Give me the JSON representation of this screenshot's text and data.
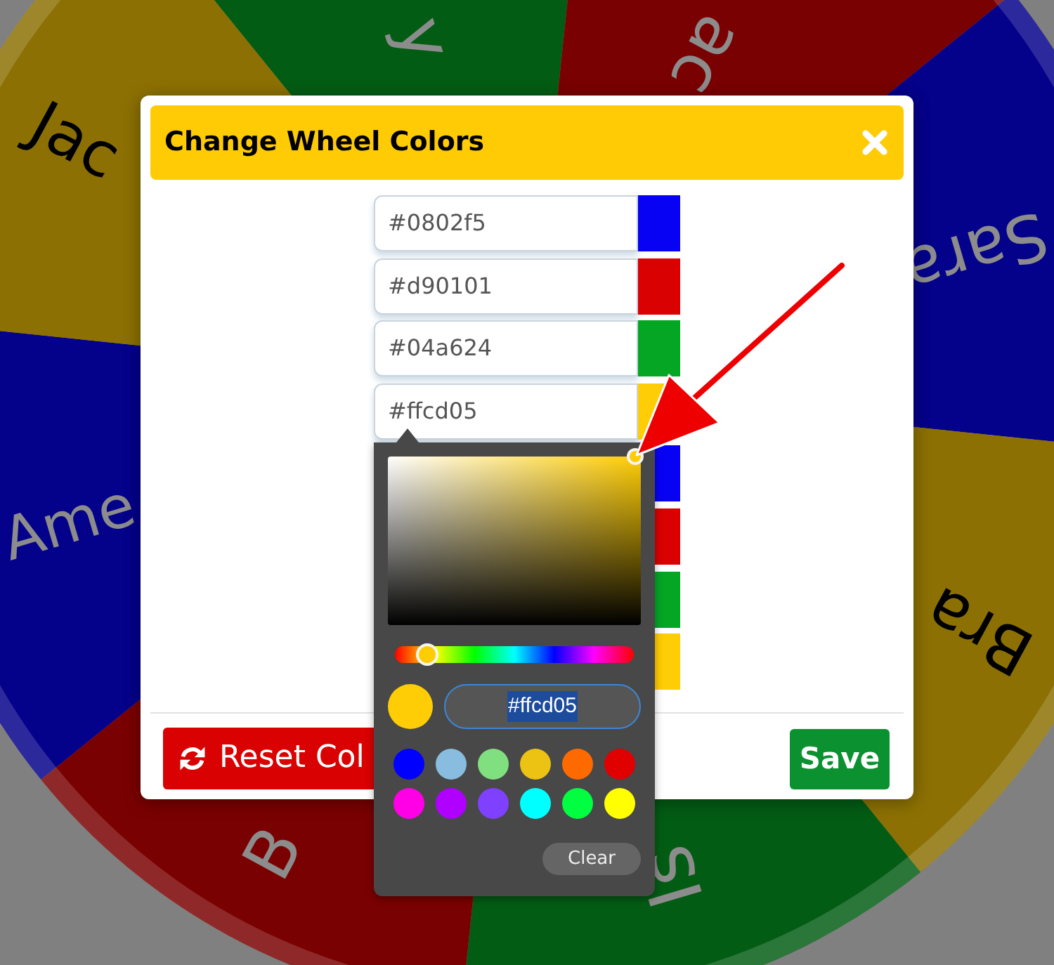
{
  "wheel": {
    "segments": [
      {
        "label": "y",
        "color": "#035c14"
      },
      {
        "label": "ac",
        "color": "#7a0101"
      },
      {
        "label": "Sara",
        "color": "#04018a"
      },
      {
        "label": "Bra",
        "color": "#8c7003"
      },
      {
        "label": "Is",
        "color": "#035c14"
      },
      {
        "label": "B",
        "color": "#7a0101"
      },
      {
        "label": "Ame",
        "color": "#04018a"
      },
      {
        "label": "Jac",
        "color": "#8c7003"
      }
    ]
  },
  "dialog": {
    "title": "Change Wheel Colors",
    "color_inputs": [
      {
        "value": "#0802f5",
        "color": "#0802f5",
        "active": false
      },
      {
        "value": "#d90101",
        "color": "#d90101",
        "active": false
      },
      {
        "value": "#04a624",
        "color": "#04a624",
        "active": false
      },
      {
        "value": "#ffcd05",
        "color": "#ffcd05",
        "active": true
      },
      {
        "color": "#0802f5",
        "active": false
      },
      {
        "color": "#d90101",
        "active": false
      },
      {
        "color": "#04a624",
        "active": false
      },
      {
        "color": "#ffcd05",
        "active": false
      }
    ],
    "color_picker": {
      "color": "#ffcd05",
      "value": "#ffcd05",
      "value_highlighted": true,
      "hue_slider": {
        "level": 0.133
      },
      "swatches": [
        {
          "color": "#0000ff"
        },
        {
          "color": "#88bde0"
        },
        {
          "color": "#80e080"
        },
        {
          "color": "#ecc213"
        },
        {
          "color": "#ff6a00"
        },
        {
          "color": "#e00000"
        },
        {
          "color": "#ff00e6"
        },
        {
          "color": "#b000ff"
        },
        {
          "color": "#8040ff"
        },
        {
          "color": "#00ffff"
        },
        {
          "color": "#00ff40"
        },
        {
          "color": "#ffff00"
        }
      ],
      "clear_label": "Clear"
    },
    "reset_label": "Reset Col",
    "save_label": "Save"
  }
}
